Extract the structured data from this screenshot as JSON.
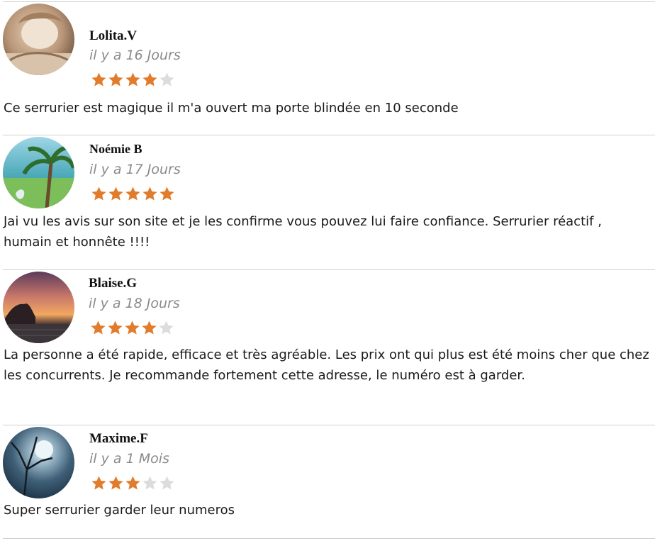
{
  "colors": {
    "star_filled": "#e27c2d",
    "star_empty": "#dcdcdc",
    "divider": "#cfcfcf",
    "timestamp": "#8a8a8a"
  },
  "reviews": [
    {
      "author": "Lolita.V",
      "avatar_icon": "avatar-child-photo",
      "time": "il y a 16 Jours",
      "rating": 4,
      "rating_max": 5,
      "text": "Ce serrurier est magique il m'a ouvert ma porte blindée en 10 seconde"
    },
    {
      "author": "Noémie B",
      "avatar_icon": "avatar-palm-tree-photo",
      "time": "il y a 17 Jours",
      "rating": 5,
      "rating_max": 5,
      "text": "Jai vu les avis sur son site et je les confirme vous pouvez lui faire confiance. Serrurier réactif , humain et honnête !!!!"
    },
    {
      "author": "Blaise.G",
      "avatar_icon": "avatar-sunset-photo",
      "time": "il y a 18 Jours",
      "rating": 4,
      "rating_max": 5,
      "text": "La personne a été rapide, efficace et très agréable. Les prix ont qui plus est été moins cher que chez les concurrents. Je recommande fortement cette adresse, le numéro est à garder."
    },
    {
      "author": "Maxime.F",
      "avatar_icon": "avatar-moon-tree-photo",
      "time": "il y a 1 Mois",
      "rating": 3,
      "rating_max": 5,
      "text": "Super serrurier garder leur numeros"
    }
  ]
}
